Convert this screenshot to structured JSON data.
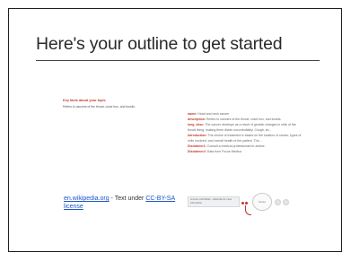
{
  "slide": {
    "title": "Here's your outline to get started",
    "left": {
      "heading": "Key facts about your topic",
      "text": "Refers to cancers of the throat, voice box, and tonsils."
    },
    "right": [
      {
        "key": "name:",
        "value": " Head and neck cancer"
      },
      {
        "key": "description:",
        "value": " Refers to cancers of the throat, voice box, and tonsils."
      },
      {
        "key": "long_desc:",
        "value": " The cancer develops as a result of genetic changes in cells of the throat lining, making them divide uncontrollably. Cough, sh..."
      },
      {
        "key": "Introduction:",
        "value": " The choice of treatment is based on the location of cancer, types of cells involved, and overall health of the patient. The..."
      },
      {
        "key": "Disclaimer1:",
        "value": " Consult a medical professional for advice."
      },
      {
        "key": "Disclaimer2:",
        "value": " Data from Focus Medica"
      }
    ],
    "footer": {
      "link_text": "en.wikipedia.org",
      "middle_text": " - Text under ",
      "license_text": "CC-BY-SA license"
    },
    "mini_ui": {
      "box_text": "Immune Cell Model · subscribe for more information",
      "circle_text": "Notes"
    }
  }
}
